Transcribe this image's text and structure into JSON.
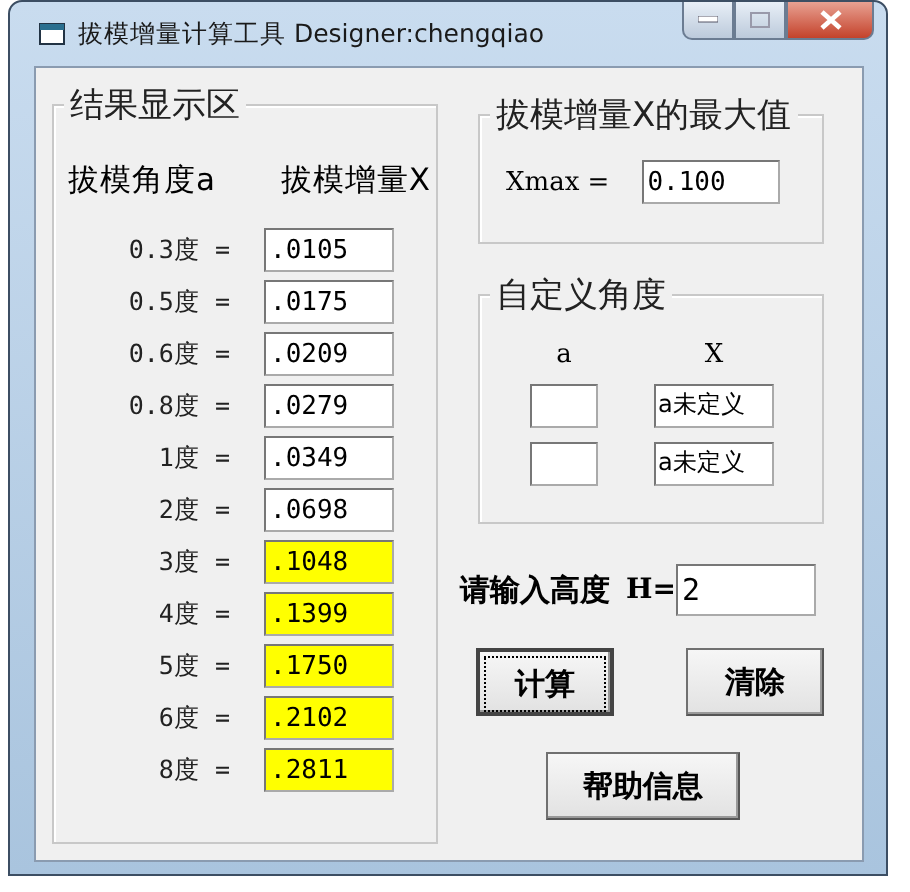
{
  "window": {
    "title": "拔模增量计算工具 Designer:chengqiao"
  },
  "results": {
    "title": "结果显示区",
    "header_angle": "拔模角度a",
    "header_value": "拔模增量X",
    "rows": [
      {
        "angle": "0.3度 =",
        "value": ".0105",
        "highlighted": false
      },
      {
        "angle": "0.5度 =",
        "value": ".0175",
        "highlighted": false
      },
      {
        "angle": "0.6度 =",
        "value": ".0209",
        "highlighted": false
      },
      {
        "angle": "0.8度 =",
        "value": ".0279",
        "highlighted": false
      },
      {
        "angle": "1度 =",
        "value": ".0349",
        "highlighted": false
      },
      {
        "angle": "2度 =",
        "value": ".0698",
        "highlighted": false
      },
      {
        "angle": "3度 =",
        "value": ".1048",
        "highlighted": true
      },
      {
        "angle": "4度 =",
        "value": ".1399",
        "highlighted": true
      },
      {
        "angle": "5度 =",
        "value": ".1750",
        "highlighted": true
      },
      {
        "angle": "6度 =",
        "value": ".2102",
        "highlighted": true
      },
      {
        "angle": "8度 =",
        "value": ".2811",
        "highlighted": true
      }
    ]
  },
  "max": {
    "title": "拔模增量X的最大值",
    "label": "Xmax =",
    "value": "0.100"
  },
  "custom": {
    "title": "自定义角度",
    "col_a": "a",
    "col_x": "X",
    "rows": [
      {
        "x": "a未定义"
      },
      {
        "x": "a未定义"
      }
    ]
  },
  "height": {
    "label": "请输入高度",
    "prefix": "H=",
    "value": "2"
  },
  "buttons": [
    {
      "label": "计算",
      "focused": true
    },
    {
      "label": "清除",
      "focused": false
    },
    {
      "label": "帮助信息",
      "focused": false
    }
  ]
}
